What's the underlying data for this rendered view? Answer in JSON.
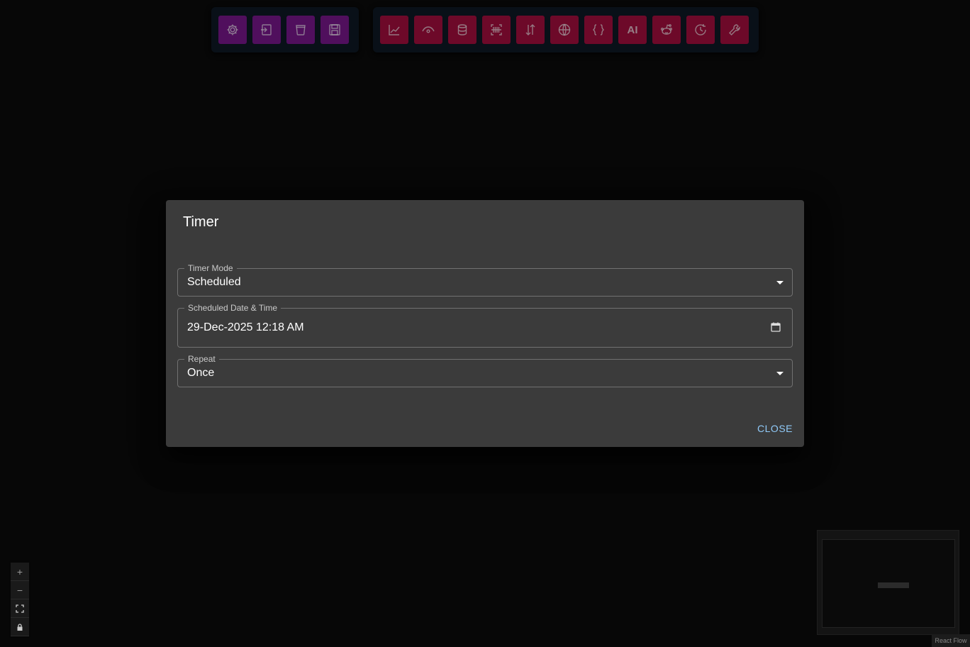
{
  "toolbar_left": {
    "buttons": [
      {
        "icon": "gear-icon"
      },
      {
        "icon": "import-icon"
      },
      {
        "icon": "trash-icon"
      },
      {
        "icon": "save-icon"
      }
    ]
  },
  "toolbar_right": {
    "buttons": [
      {
        "icon": "chart-icon"
      },
      {
        "icon": "eye-icon"
      },
      {
        "icon": "database-icon"
      },
      {
        "icon": "barcode-icon"
      },
      {
        "icon": "sort-arrows-icon"
      },
      {
        "icon": "www-icon"
      },
      {
        "icon": "braces-icon"
      },
      {
        "icon": "ai-icon",
        "label": "AI"
      },
      {
        "icon": "reddit-icon"
      },
      {
        "icon": "clock-icon"
      },
      {
        "icon": "wrench-ai-icon"
      }
    ]
  },
  "dialog": {
    "title": "Timer",
    "timer_mode": {
      "label": "Timer Mode",
      "value": "Scheduled"
    },
    "scheduled": {
      "label": "Scheduled Date & Time",
      "value": "29-Dec-2025 12:18 AM"
    },
    "repeat": {
      "label": "Repeat",
      "value": "Once"
    },
    "close_label": "CLOSE"
  },
  "controls": {
    "zoom_in": "+",
    "zoom_out": "−"
  },
  "attribution": "React Flow",
  "colors": {
    "background": "#0b0b0b",
    "dialog": "#3b3b3b",
    "toolbar_left_button": "#7b1790",
    "toolbar_right_button": "#a80f40",
    "accent": "#90caf9"
  }
}
